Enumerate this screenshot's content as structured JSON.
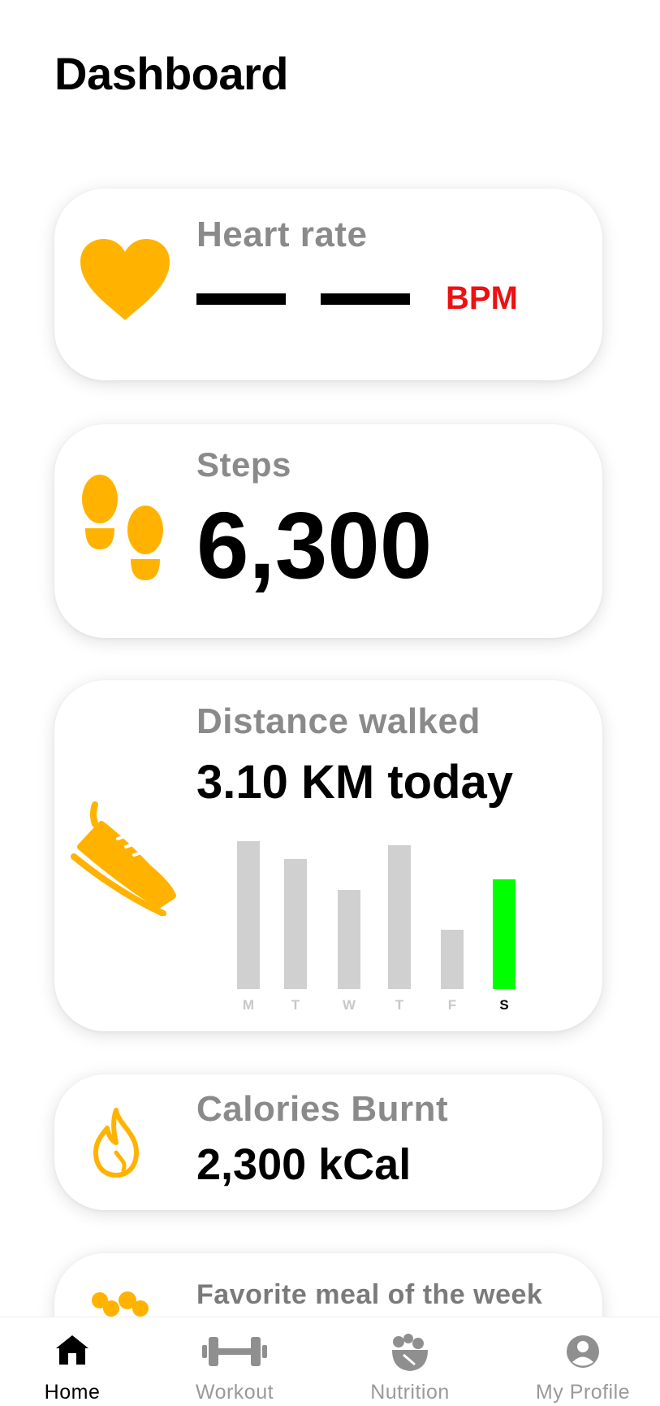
{
  "page": {
    "title": "Dashboard"
  },
  "colors": {
    "accent": "#FFB300",
    "bpm": "#EE1111",
    "active_bar": "#00FF00",
    "inactive_bar": "#D0D0D0",
    "label_gray": "#8A8A8A"
  },
  "heart_rate": {
    "label": "Heart rate",
    "value": "— —",
    "unit": "BPM",
    "icon": "heart-icon"
  },
  "steps": {
    "label": "Steps",
    "value": "6,300",
    "icon": "footprints-icon"
  },
  "distance": {
    "label": "Distance walked",
    "value": "3.10 KM today",
    "icon": "sneaker-icon",
    "chart_data": {
      "type": "bar",
      "categories": [
        "M",
        "T",
        "W",
        "T",
        "F",
        "S"
      ],
      "values": [
        1.0,
        0.88,
        0.67,
        0.97,
        0.4,
        0.74
      ],
      "highlight_index": 5
    }
  },
  "calories": {
    "label": "Calories Burnt",
    "value": "2,300 kCal",
    "icon": "flame-icon"
  },
  "meal": {
    "label": "Favorite meal of the week",
    "icon": "food-icon"
  },
  "bottom_nav": [
    {
      "label": "Home",
      "icon": "home-icon",
      "active": true
    },
    {
      "label": "Workout",
      "icon": "dumbbell-icon",
      "active": false
    },
    {
      "label": "Nutrition",
      "icon": "salad-icon",
      "active": false
    },
    {
      "label": "My Profile",
      "icon": "account-icon",
      "active": false
    }
  ]
}
